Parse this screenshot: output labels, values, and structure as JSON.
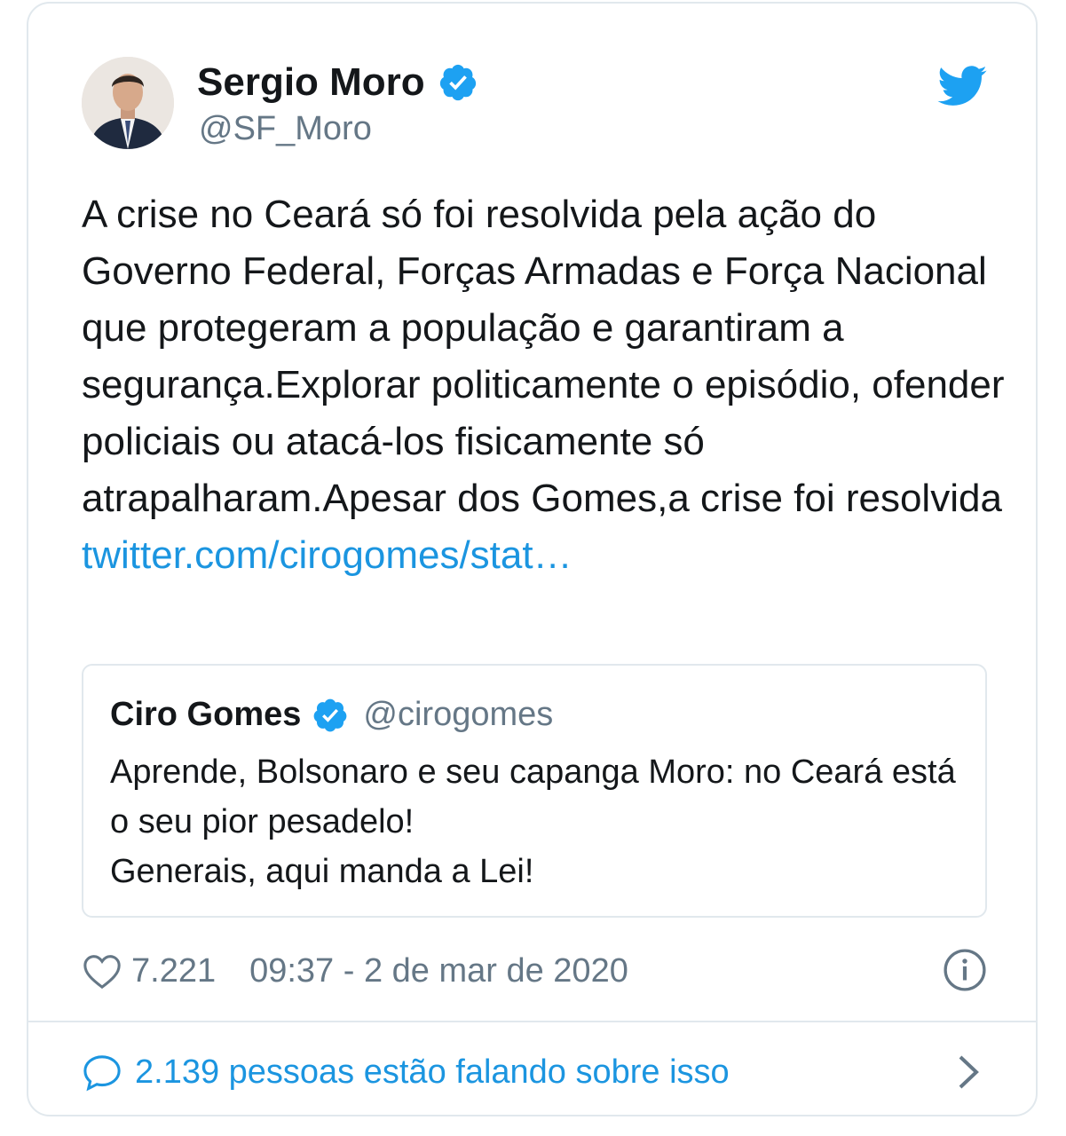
{
  "tweet": {
    "author_name": "Sergio Moro",
    "author_handle": "@SF_Moro",
    "text": "A crise no Ceará só foi resolvida pela ação do Governo Federal, Forças Armadas e Força Nacional que protegeram a população e garantiram a segurança.Explorar politicamente o episódio, ofender policiais ou atacá-los fisicamente só atrapalharam.Apesar dos Gomes,a crise foi resolvida",
    "link": "twitter.com/cirogomes/stat…",
    "likes": "7.221",
    "timestamp": "09:37 - 2 de mar de 2020",
    "conversation": "2.139 pessoas estão falando sobre isso"
  },
  "quoted": {
    "author_name": "Ciro Gomes",
    "author_handle": "@cirogomes",
    "text": "Aprende, Bolsonaro e seu capanga Moro: no Ceará está o seu pior pesadelo!\nGenerais, aqui manda a Lei!"
  },
  "colors": {
    "twitter_blue": "#1da1f2",
    "link_blue": "#1b95e0",
    "secondary_text": "#657786",
    "border": "#e1e8ed"
  },
  "icons": [
    "verified-badge-icon",
    "twitter-bird-icon",
    "heart-icon",
    "info-icon",
    "comment-bubble-icon",
    "chevron-right-icon"
  ]
}
